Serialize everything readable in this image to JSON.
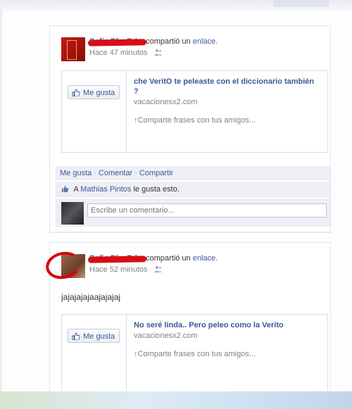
{
  "colors": {
    "link": "#3b5998",
    "redaction": "#d60f17",
    "meta": "#808080",
    "panel": "#edeff4"
  },
  "icons": {
    "people": "people-icon",
    "like": "thumbs-up-icon"
  },
  "story1": {
    "actor": "Sofia Dl... Bd...",
    "verb": "compartió un",
    "object": "enlace.",
    "time": "Hace 47 minutos",
    "attachment": {
      "like_label": "Me gusta",
      "title": "che VeritO te peleaste con el diccionario también ?",
      "domain": "vacacionesx2.com",
      "description": "↑Comparte frases con tus amigos..."
    },
    "actions": {
      "like": "Me gusta",
      "comment": "Comentar",
      "share": "Compartir",
      "sep": "·"
    },
    "likes": {
      "prefix": "A",
      "name": "Mathias Pintos",
      "suffix": "le gusta esto."
    },
    "comment_placeholder": "Escribe un comentario..."
  },
  "story2": {
    "actor": "Sofia Dl... Bd...",
    "verb": "compartió un",
    "object": "enlace.",
    "time": "Hace 52 minutos",
    "message": "jajajajajaajajajaj",
    "attachment": {
      "like_label": "Me gusta",
      "title": "No seré linda.. Pero peleo como la Verito",
      "domain": "vacacionesx2.com",
      "description": "↑Comparte frases con tus amigos..."
    }
  }
}
